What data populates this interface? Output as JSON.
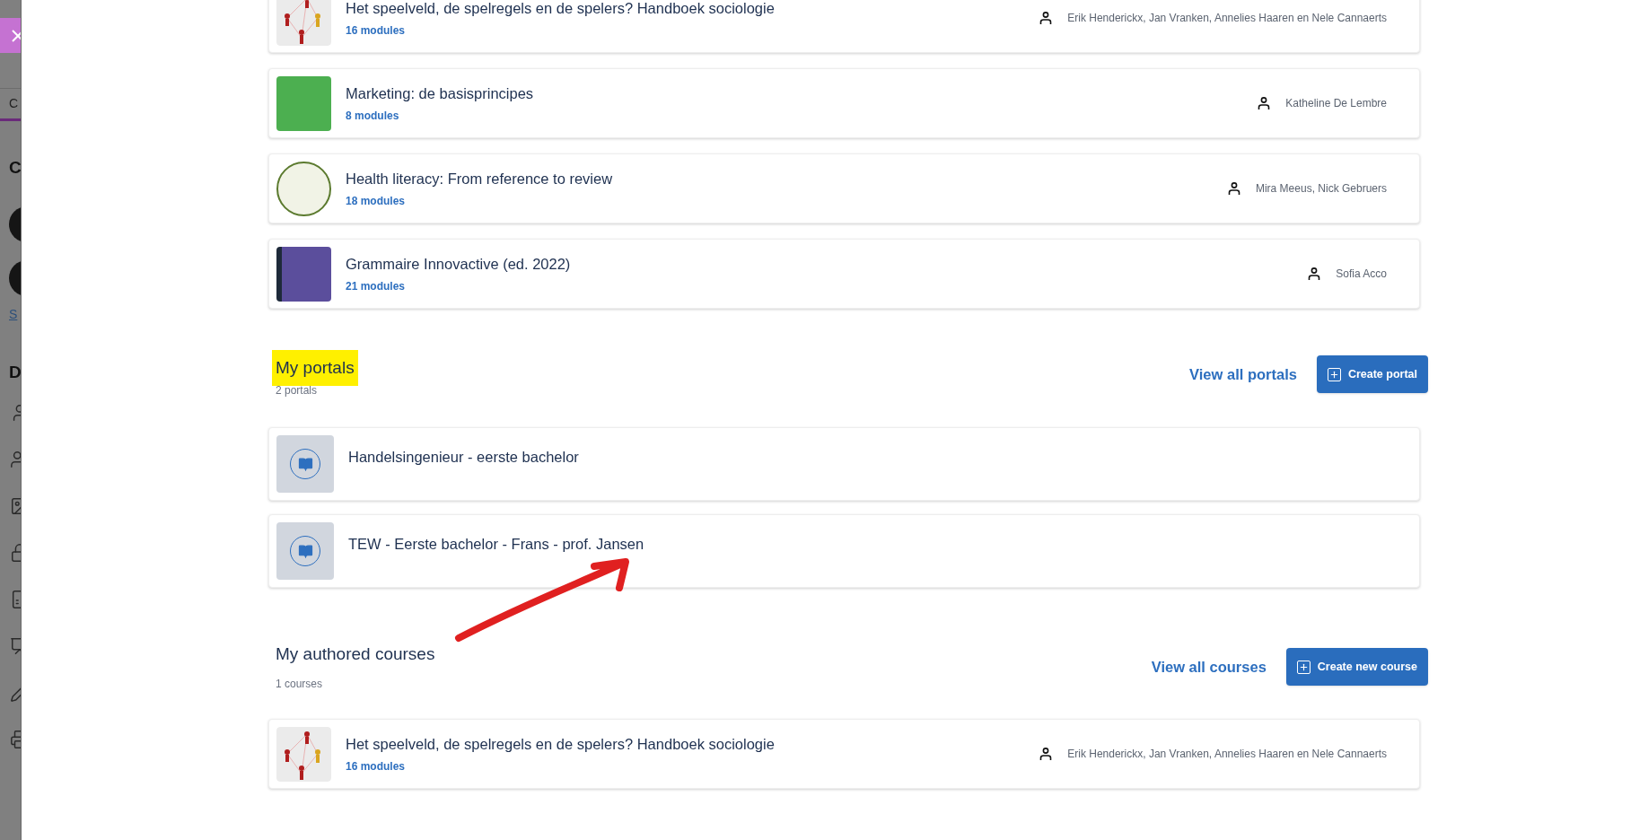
{
  "sidebar": {
    "texts": [
      {
        "text": "C",
        "kind": "tab"
      },
      {
        "text": "C",
        "kind": "heading"
      },
      {
        "text": "S",
        "kind": "link"
      },
      {
        "text": "D",
        "kind": "heading"
      }
    ]
  },
  "recent_courses": [
    {
      "title": "Het speelveld, de spelregels en de spelers? Handboek sociologie",
      "modules": "16 modules",
      "authors": "Erik Henderickx, Jan Vranken, Annelies Haaren en Nele Cannaerts",
      "kind": "network"
    },
    {
      "title": "Marketing: de basisprincipes",
      "modules": "8 modules",
      "authors": "Katheline De Lembre",
      "kind": "photo"
    },
    {
      "title": "Health literacy: From reference to review",
      "modules": "18 modules",
      "authors": "Mira Meeus, Nick Gebruers",
      "kind": "wordcloud"
    },
    {
      "title": "Grammaire Innovactive (ed. 2022)",
      "modules": "21 modules",
      "authors": "Sofia Acco",
      "kind": "book"
    }
  ],
  "portals": {
    "title": "My portals",
    "highlighted": true,
    "count": "2 portals",
    "view_all": "View all portals",
    "create": "Create portal",
    "items": [
      {
        "title": "Handelsingenieur - eerste bachelor"
      },
      {
        "title": "TEW - Eerste bachelor - Frans - prof. Jansen"
      }
    ]
  },
  "authored": {
    "title": "My authored courses",
    "highlighted": false,
    "count": "1 courses",
    "view_all": "View all courses",
    "create": "Create new course",
    "items": [
      {
        "title": "Het speelveld, de spelregels en de spelers? Handboek sociologie",
        "modules": "16 modules",
        "authors": "Erik Henderickx, Jan Vranken, Annelies Haaren en Nele Cannaerts",
        "kind": "network"
      }
    ]
  }
}
